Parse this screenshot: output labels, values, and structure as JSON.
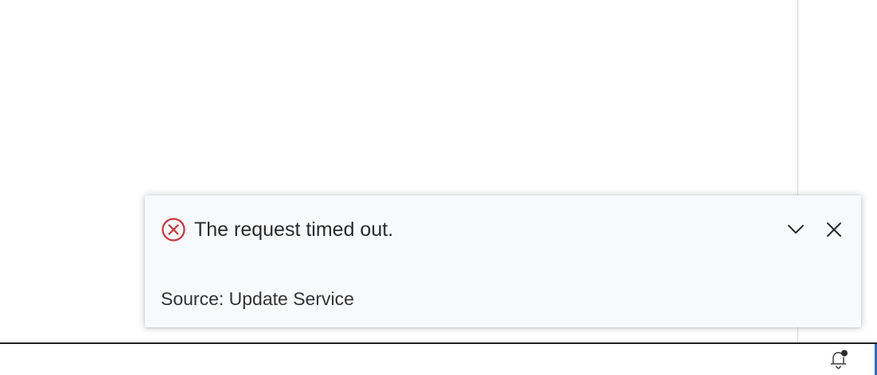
{
  "notification": {
    "severity": "error",
    "message": "The request timed out.",
    "source": "Source: Update Service",
    "icons": {
      "status": "error-circle-x-icon",
      "expand": "chevron-down-icon",
      "close": "close-icon"
    },
    "colors": {
      "error": "#d1323a",
      "background": "#f8f9fb",
      "text": "#2b2b2b"
    }
  },
  "status_bar": {
    "notifications_icon": "bell-dot-icon",
    "accent_color": "#1a73d9"
  }
}
